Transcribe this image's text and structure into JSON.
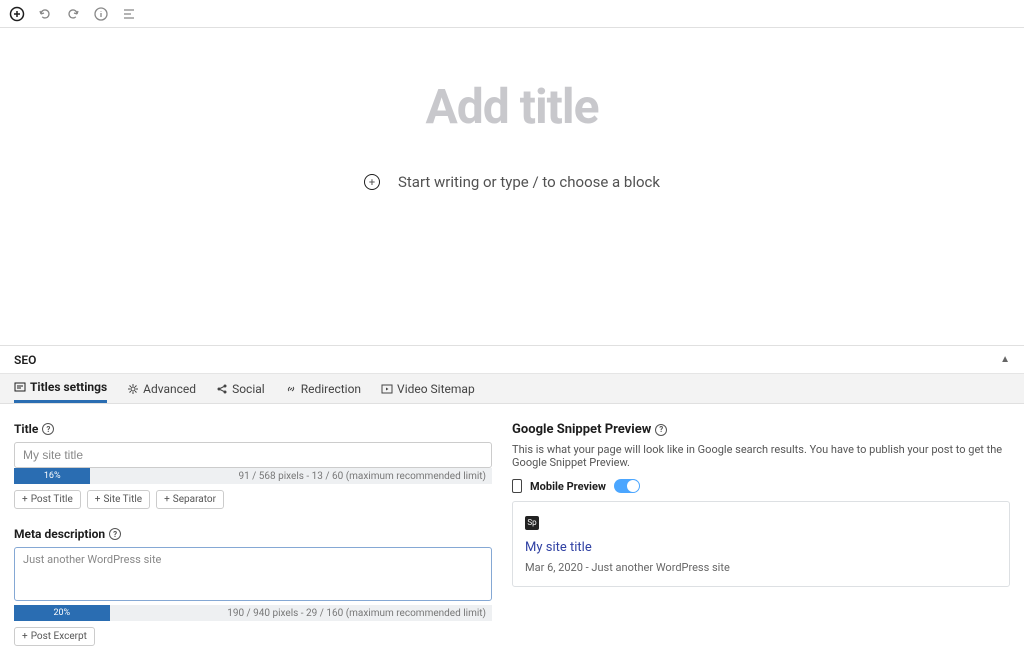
{
  "editor": {
    "title_placeholder": "Add title",
    "block_prompt": "Start writing or type / to choose a block"
  },
  "seo": {
    "panel_label": "SEO",
    "tabs": [
      {
        "label": "Titles settings"
      },
      {
        "label": "Advanced"
      },
      {
        "label": "Social"
      },
      {
        "label": "Redirection"
      },
      {
        "label": "Video Sitemap"
      }
    ],
    "title": {
      "label": "Title",
      "value": "My site title",
      "progress_pct": "16%",
      "limit": "91 / 568 pixels - 13 / 60 (maximum recommended limit)",
      "tags": [
        "Post Title",
        "Site Title",
        "Separator"
      ]
    },
    "meta": {
      "label": "Meta description",
      "value": "Just another WordPress site",
      "progress_pct": "20%",
      "limit": "190 / 940 pixels - 29 / 160 (maximum recommended limit)",
      "tags": [
        "Post Excerpt"
      ]
    },
    "preview": {
      "title": "Google Snippet Preview",
      "desc": "This is what your page will look like in Google search results. You have to publish your post to get the Google Snippet Preview.",
      "mobile_label": "Mobile Preview",
      "snippet_title": "My site title",
      "snippet_date": "Mar 6, 2020",
      "snippet_desc": "Just another WordPress site"
    }
  }
}
